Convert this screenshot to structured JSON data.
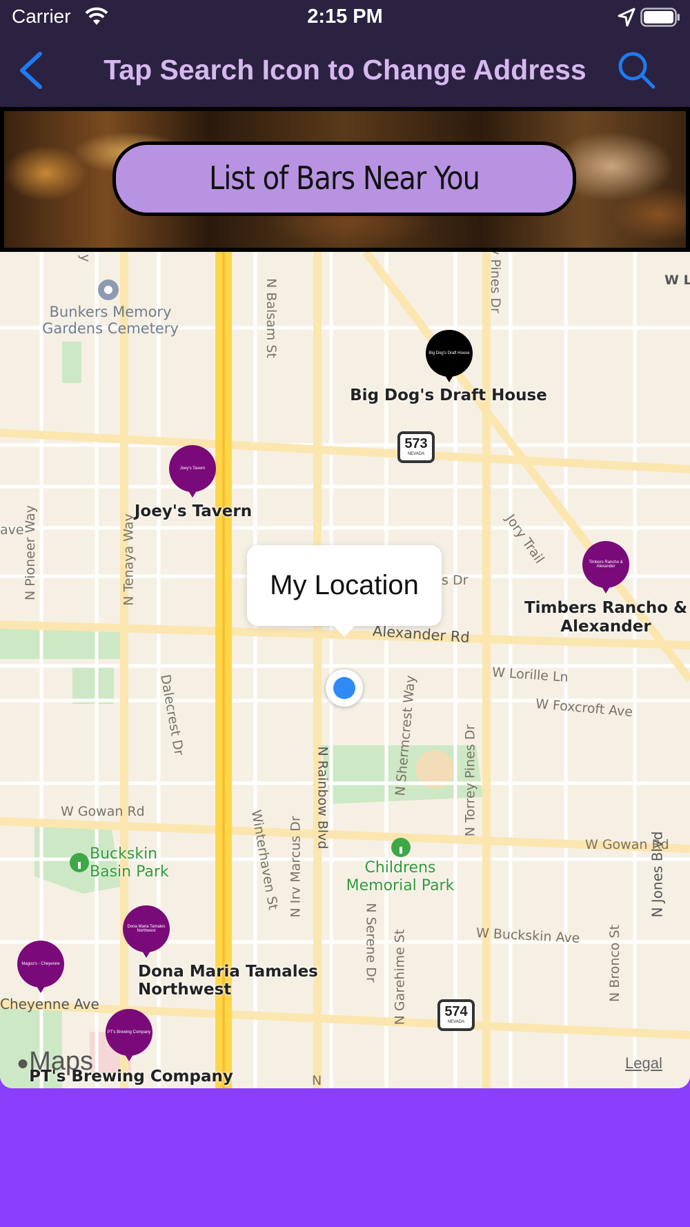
{
  "status_bar": {
    "carrier": "Carrier",
    "time": "2:15 PM",
    "icons": [
      "wifi-icon",
      "location-arrow-icon",
      "battery-icon"
    ]
  },
  "nav": {
    "title": "Tap Search Icon to Change Address",
    "back_icon": "chevron-left-icon",
    "search_icon": "magnifier-icon",
    "accent": "#1E7BF2",
    "title_color": "#D6B8EF"
  },
  "banner": {
    "button_label": "List of Bars Near You",
    "button_color": "#B893E2"
  },
  "map": {
    "callout": "My Location",
    "bars": [
      {
        "name": "Big Dog's Draft House",
        "pin_text": "Big Dog's Draft House",
        "color": "#000000"
      },
      {
        "name": "Joey's Tavern",
        "pin_text": "Joey's Tavern",
        "color": "#7A0A7A"
      },
      {
        "name": "Timbers Rancho & Alexander",
        "pin_text": "Timbers Rancho & Alexander",
        "color": "#7A0A7A"
      },
      {
        "name": "Dona Maria Tamales Northwest",
        "pin_text": "Dona Maria Tamales Northwest",
        "color": "#7A0A7A"
      },
      {
        "name": "",
        "pin_text": "Magoo's - Cheyenne",
        "color": "#7A0A7A"
      },
      {
        "name": "PT's Brewing Company",
        "pin_text": "PT's Brewing Company",
        "color": "#7A0A7A"
      }
    ],
    "streets": {
      "balsam": "N Balsam St",
      "pines_top": "y Pines Dr",
      "w_l": "W L",
      "pioneer": "N Pioneer Way",
      "tenaya": "N Tenaya Way",
      "ave_left": "ave",
      "alexander": "Alexander Rd",
      "s_dr": "s Dr",
      "jory": "Jory Trail",
      "lorille": "W Lorille Ln",
      "foxcroft": "W Foxcroft Ave",
      "dalecrest": "Dalecrest Dr",
      "shermcrest": "N Shermcrest Way",
      "torrey": "N Torrey Pines Dr",
      "gowan_left": "W Gowan Rd",
      "gowan_right": "W Gowan Rd",
      "rainbow": "N Rainbow Blvd",
      "irv_marcus": "N Irv Marcus Dr",
      "winterhaven": "Winterhaven St",
      "buckskin_ave": "W Buckskin Ave",
      "jones": "N Jones Blvd",
      "serene": "N Serene Dr",
      "garehime": "N Garehime St",
      "bronco": "N Bronco St",
      "cheyenne": "Cheyenne Ave",
      "y_top": "y",
      "n_bottom": "N"
    },
    "places": {
      "cemetery": "Bunkers Memory Gardens Cemetery",
      "buckskin_park": "Buckskin Basin Park",
      "childrens_park": "Childrens Memorial Park"
    },
    "route_shields": [
      {
        "number": "573",
        "state": "NEVADA"
      },
      {
        "number": "574",
        "state": "NEVADA"
      }
    ],
    "attribution": {
      "logo": "Maps",
      "legal": "Legal"
    },
    "colors": {
      "land": "#F6F0E4",
      "highway": "#FFD64A",
      "arterial": "#FCE6B0",
      "park": "#CDE8C4",
      "user_dot": "#2F8AF5"
    }
  },
  "background_color": "#8A3FFC"
}
